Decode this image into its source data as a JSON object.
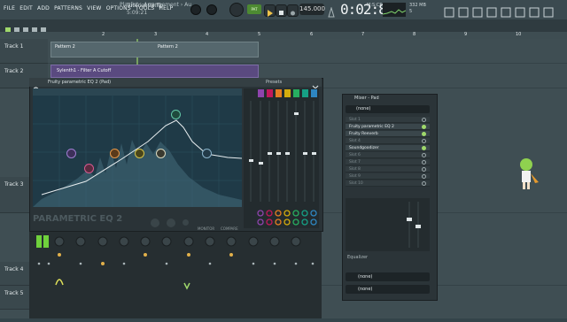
{
  "menu": {
    "items": [
      "FILE",
      "EDIT",
      "ADD",
      "PATTERNS",
      "VIEW",
      "OPTIONS",
      "TOOLS",
      "HELP"
    ]
  },
  "song": {
    "title": "Tutorial 98.flp",
    "time": "5:09:21"
  },
  "toolbar": {
    "pattern_button": "PAT",
    "tempo": "145.000",
    "clock": "0:02:81",
    "clock_sub": "M:S:CS",
    "ram_label": "332 MB",
    "cpu_label": "5"
  },
  "playlist": {
    "breadcrumb": "Playlist - Arrangement › Au",
    "ruler_ticks": [
      "2",
      "3",
      "4",
      "5",
      "6",
      "7",
      "8",
      "9",
      "10"
    ],
    "tracks": [
      {
        "label": "Track 1"
      },
      {
        "label": "Track 2"
      },
      {
        "label": "Track 3"
      },
      {
        "label": "Track 4"
      },
      {
        "label": "Track 5"
      }
    ],
    "clips": {
      "pattern_a": "Pattern 2",
      "pattern_b": "Pattern 2",
      "automation": "Sylenth1 - Filter A Cutoff"
    }
  },
  "eq_window": {
    "title": "Fruity parametric EQ 2 (Pad)",
    "presets_label": "Presets",
    "logo": "PARAMETRIC EQ 2",
    "band_colors": [
      "#8e44ad",
      "#c2185b",
      "#e67e22",
      "#d4ac0d",
      "#27ae60",
      "#16a085",
      "#2e86c1"
    ],
    "mode_labels": [
      "MONITOR",
      "COMPARE"
    ]
  },
  "mixer_window": {
    "title": "Mixer - Pad",
    "input_select": "(none)",
    "slots": [
      {
        "label": "Slot 1",
        "active": false
      },
      {
        "label": "Fruity parametric EQ 2",
        "active": true
      },
      {
        "label": "Fruity Reeverb",
        "active": true
      },
      {
        "label": "Slot 4",
        "active": false
      },
      {
        "label": "Soundgoodizer",
        "active": true
      },
      {
        "label": "Slot 6",
        "active": false
      },
      {
        "label": "Slot 7",
        "active": false
      },
      {
        "label": "Slot 8",
        "active": false
      },
      {
        "label": "Slot 9",
        "active": false
      },
      {
        "label": "Slot 10",
        "active": false
      }
    ],
    "equalizer_label": "Equalizer",
    "output_a": "(none)",
    "output_b": "(none)"
  },
  "colors": {
    "accent_green": "#9fd86b",
    "automation_clip": "#5a4a80",
    "eq_bg": "#1f3a47"
  }
}
